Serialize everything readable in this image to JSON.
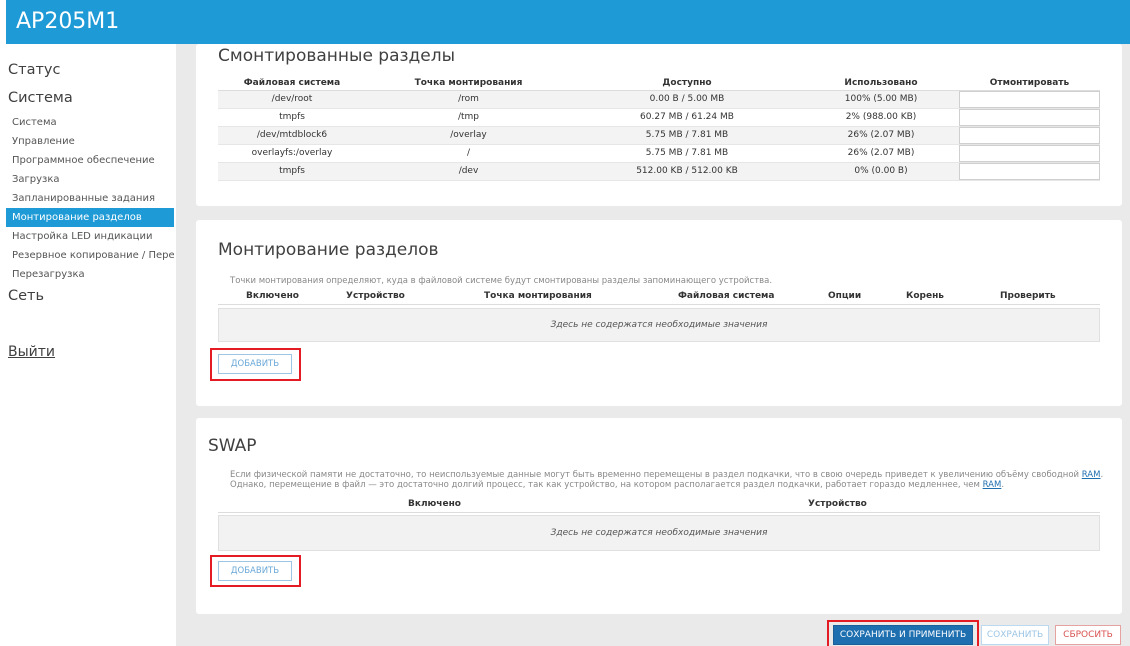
{
  "app": {
    "title": "AP205M1"
  },
  "sidebar": {
    "status": "Статус",
    "system": "Система",
    "items": [
      "Система",
      "Управление",
      "Программное обеспечение",
      "Загрузка",
      "Запланированные задания",
      "Монтирование разделов",
      "Настройка LED индикации",
      "Резервное копирование / Перепрошивка",
      "Перезагрузка"
    ],
    "active_index": 5,
    "network": "Сеть",
    "logout": "Выйти"
  },
  "mounted": {
    "title": "Смонтированные разделы",
    "columns": [
      "Файловая система",
      "Точка монтирования",
      "Доступно",
      "Использовано",
      "Отмонтировать"
    ],
    "rows": [
      [
        "/dev/root",
        "/rom",
        "0.00 B / 5.00 MB",
        "100% (5.00 MB)"
      ],
      [
        "tmpfs",
        "/tmp",
        "60.27 MB / 61.24 MB",
        "2% (988.00 KB)"
      ],
      [
        "/dev/mtdblock6",
        "/overlay",
        "5.75 MB / 7.81 MB",
        "26% (2.07 MB)"
      ],
      [
        "overlayfs:/overlay",
        "/",
        "5.75 MB / 7.81 MB",
        "26% (2.07 MB)"
      ],
      [
        "tmpfs",
        "/dev",
        "512.00 KB / 512.00 KB",
        "0% (0.00 B)"
      ]
    ]
  },
  "mount": {
    "title": "Монтирование разделов",
    "description": "Точки монтирования определяют, куда в файловой системе будут смонтированы разделы запоминающего устройства.",
    "columns": [
      "Включено",
      "Устройство",
      "Точка монтирования",
      "Файловая система",
      "Опции",
      "Корень",
      "Проверить"
    ],
    "empty": "Здесь не содержатся необходимые значения",
    "add": "ДОБАВИТЬ"
  },
  "swap": {
    "title": "SWAP",
    "desc_1": "Если физической памяти не достаточно, то неиспользуемые данные могут быть временно перемещены в раздел подкачки, что в свою очередь приведет к увеличению объёму свободной",
    "desc_ram": "RAM",
    "desc_2": ". Однако, перемещение в файл — это достаточно долгий процесс, так как устройство, на котором располагается раздел подкачки, работает гораздо медленнее, чем",
    "desc_end": ".",
    "columns": [
      "Включено",
      "Устройство"
    ],
    "empty": "Здесь не содержатся необходимые значения",
    "add": "ДОБАВИТЬ"
  },
  "footer": {
    "apply": "СОХРАНИТЬ И ПРИМЕНИТЬ",
    "save": "СОХРАНИТЬ",
    "reset": "СБРОСИТЬ"
  },
  "colors": {
    "accent": "#1e9ad6",
    "highlight": "#e51b24",
    "primary_button": "#1e6fb0"
  }
}
